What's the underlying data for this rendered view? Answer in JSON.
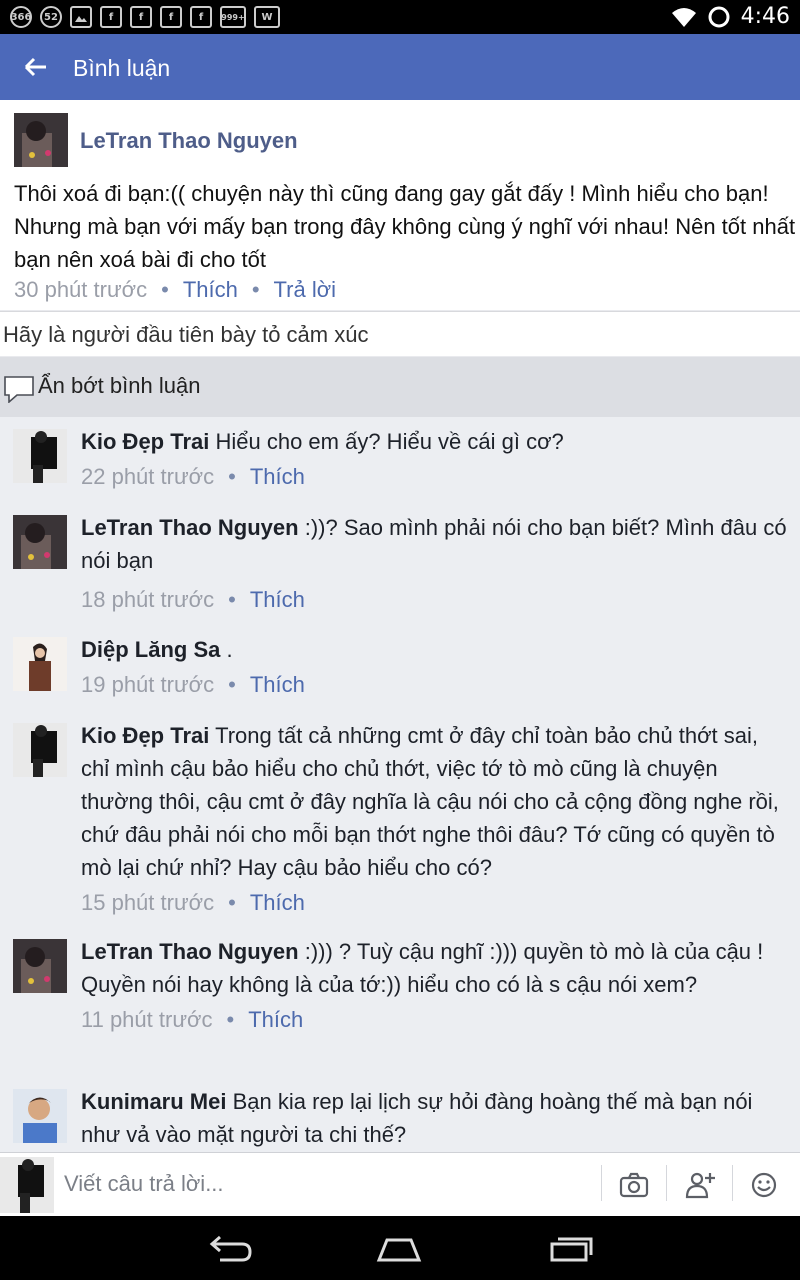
{
  "status_bar": {
    "time": "4:46",
    "notification_icons": [
      "366",
      "52",
      "image-icon",
      "facebook-icon",
      "facebook-icon",
      "facebook-icon",
      "facebook-icon",
      "999+",
      "w-icon"
    ]
  },
  "app_bar": {
    "title": "Bình luận"
  },
  "post": {
    "author": "LeTran Thao Nguyen",
    "text": "Thôi xoá đi bạn:(( chuyện này thì cũng đang gay gắt đấy ! Mình hiểu cho bạn! Nhưng mà bạn với mấy bạn trong đây không cùng ý nghĩ với nhau! Nên tốt nhất bạn nên xoá bài đi cho tốt",
    "time": "30 phút trước",
    "like": "Thích",
    "reply": "Trả lời"
  },
  "reaction_prompt": "Hãy là người đầu tiên bày tỏ cảm xúc",
  "hide_replies": "Ẩn bớt bình luận",
  "replies": [
    {
      "author": "Kio Đẹp Trai",
      "text": "Hiểu cho em ấy? Hiểu về cái gì cơ?",
      "time": "22 phút trước",
      "like": "Thích"
    },
    {
      "author": "LeTran Thao Nguyen",
      "text": ":))? Sao mình phải nói cho bạn biết? Mình đâu có nói bạn",
      "time": "18 phút trước",
      "like": "Thích"
    },
    {
      "author": "Diệp Lăng Sa",
      "text": ".",
      "time": "19 phút trước",
      "like": "Thích"
    },
    {
      "author": "Kio Đẹp Trai",
      "text": "Trong tất cả những cmt ở đây chỉ toàn bảo chủ thớt sai, chỉ mình cậu bảo hiểu cho chủ thớt, việc tớ tò mò cũng là chuyện thường thôi, cậu cmt ở đây nghĩa là cậu nói cho cả cộng đồng nghe rồi, chứ đâu phải nói cho mỗi bạn thớt nghe thôi đâu? Tớ cũng có quyền tò mò lại chứ nhỉ? Hay cậu bảo hiểu cho có?",
      "time": "15 phút trước",
      "like": "Thích"
    },
    {
      "author": "LeTran Thao Nguyen",
      "text": ":))) ? Tuỳ cậu nghĩ :))) quyền tò mò là của cậu ! Quyền nói hay không là của tớ:)) hiểu cho có là s cậu nói xem?",
      "time": "11 phút trước",
      "like": "Thích"
    },
    {
      "author": "Kunimaru Mei",
      "text": "Bạn kia rep lại lịch sự hỏi đàng hoàng thế mà bạn nói như vả vào mặt người ta chi thế?",
      "time": "",
      "like": ""
    }
  ],
  "composer": {
    "placeholder": "Viết câu trả lời..."
  },
  "colors": {
    "brand": "#4c69ba",
    "link": "#4d6aad",
    "author": "#4e5d89"
  }
}
